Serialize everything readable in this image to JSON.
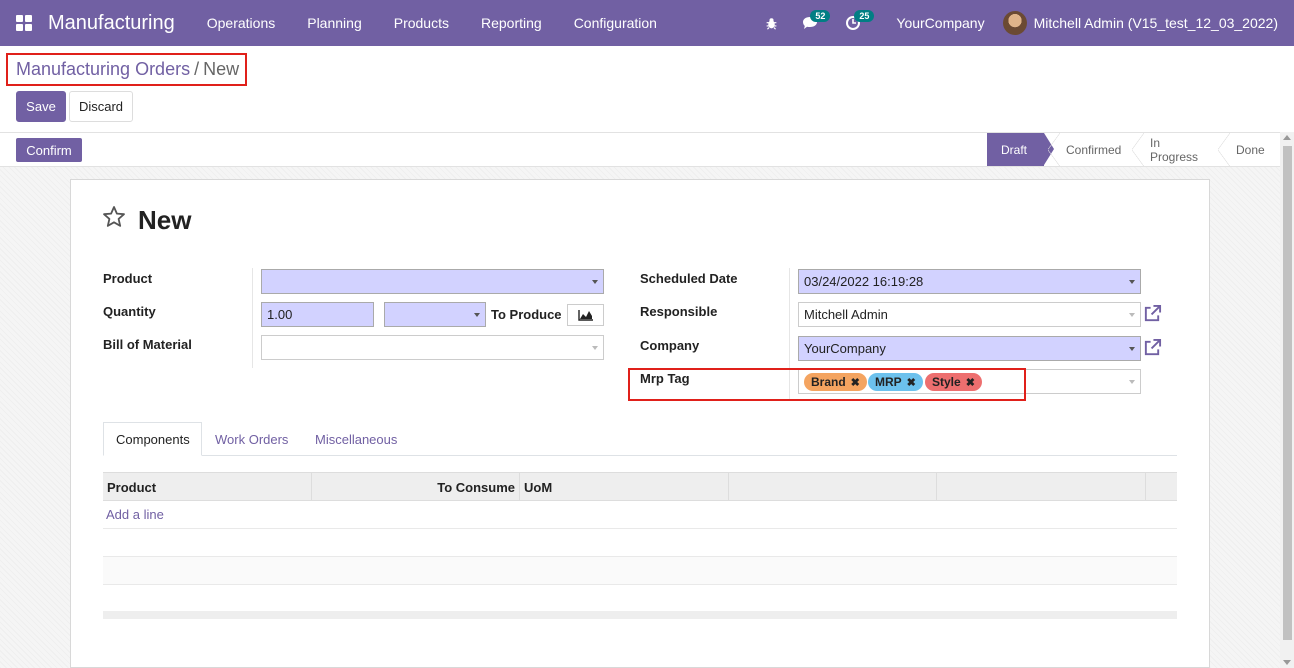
{
  "navbar": {
    "app_name": "Manufacturing",
    "menu": [
      "Operations",
      "Planning",
      "Products",
      "Reporting",
      "Configuration"
    ],
    "messages_count": "52",
    "activities_count": "25",
    "company": "YourCompany",
    "user": "Mitchell Admin (V15_test_12_03_2022)"
  },
  "breadcrumb": {
    "parent": "Manufacturing Orders",
    "separator": "/",
    "current": "New"
  },
  "control": {
    "save_label": "Save",
    "discard_label": "Discard"
  },
  "statusbar": {
    "confirm_label": "Confirm",
    "stages": [
      "Draft",
      "Confirmed",
      "In Progress",
      "Done"
    ],
    "active_stage": "Draft"
  },
  "form": {
    "title": "New",
    "left": {
      "product_label": "Product",
      "product_value": "",
      "quantity_label": "Quantity",
      "quantity_value": "1.00",
      "uom_value": "",
      "to_produce_label": "To Produce",
      "bom_label": "Bill of Material",
      "bom_value": ""
    },
    "right": {
      "scheduled_label": "Scheduled Date",
      "scheduled_value": "03/24/2022 16:19:28",
      "responsible_label": "Responsible",
      "responsible_value": "Mitchell Admin",
      "company_label": "Company",
      "company_value": "YourCompany",
      "tag_label": "Mrp Tag",
      "tags": [
        {
          "name": "Brand",
          "color": "#f4a460"
        },
        {
          "name": "MRP",
          "color": "#6cc1ed"
        },
        {
          "name": "Style",
          "color": "#ed6f6f"
        }
      ]
    },
    "tabs": [
      "Components",
      "Work Orders",
      "Miscellaneous"
    ],
    "table": {
      "headers": [
        "Product",
        "To Consume",
        "UoM"
      ],
      "add_line": "Add a line"
    }
  },
  "colors": {
    "primary": "#7160a3",
    "highlight_border": "#e0201a",
    "required_bg": "#d2d2ff"
  }
}
